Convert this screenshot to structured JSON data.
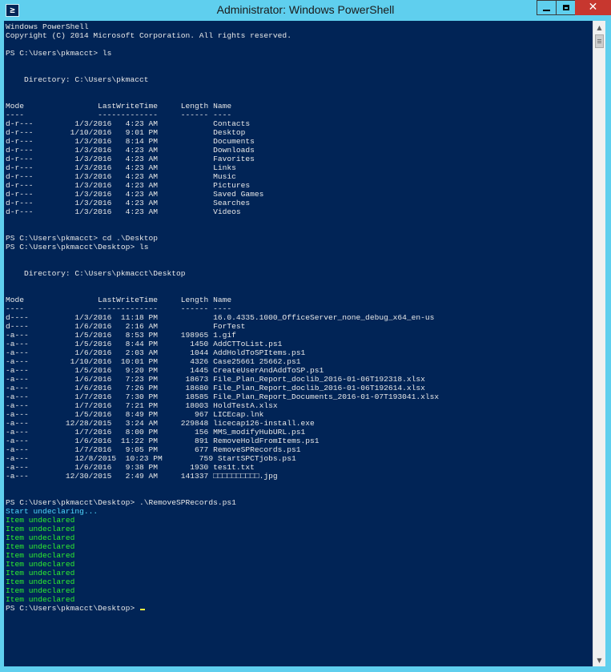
{
  "window": {
    "title": "Administrator: Windows PowerShell",
    "app_icon_glyph": "≥",
    "buttons": {
      "minimize_icon": "minimize-icon",
      "maximize_icon": "maximize-icon",
      "close_glyph": "✕"
    },
    "colors": {
      "frame": "#5fcfee",
      "console_background": "#012456",
      "text": "#e8e8e8",
      "highlight_text": "#52d8ff",
      "success_text": "#2ef02e",
      "cursor": "#ffff40",
      "close_button": "#c7372f"
    }
  },
  "console": {
    "lines": [
      {
        "text": "Windows PowerShell",
        "style": "normal"
      },
      {
        "text": "Copyright (C) 2014 Microsoft Corporation. All rights reserved.",
        "style": "normal"
      },
      {
        "text": "",
        "style": "normal"
      },
      {
        "text": "PS C:\\Users\\pkmacct> ls",
        "style": "normal"
      },
      {
        "text": "",
        "style": "normal"
      },
      {
        "text": "",
        "style": "normal"
      },
      {
        "text": "    Directory: C:\\Users\\pkmacct",
        "style": "normal"
      },
      {
        "text": "",
        "style": "normal"
      },
      {
        "text": "",
        "style": "normal"
      },
      {
        "text": "Mode                LastWriteTime     Length Name",
        "style": "normal"
      },
      {
        "text": "----                -------------     ------ ----",
        "style": "normal"
      },
      {
        "text": "d-r---         1/3/2016   4:23 AM            Contacts",
        "style": "normal"
      },
      {
        "text": "d-r---        1/10/2016   9:01 PM            Desktop",
        "style": "normal"
      },
      {
        "text": "d-r---         1/3/2016   8:14 PM            Documents",
        "style": "normal"
      },
      {
        "text": "d-r---         1/3/2016   4:23 AM            Downloads",
        "style": "normal"
      },
      {
        "text": "d-r---         1/3/2016   4:23 AM            Favorites",
        "style": "normal"
      },
      {
        "text": "d-r---         1/3/2016   4:23 AM            Links",
        "style": "normal"
      },
      {
        "text": "d-r---         1/3/2016   4:23 AM            Music",
        "style": "normal"
      },
      {
        "text": "d-r---         1/3/2016   4:23 AM            Pictures",
        "style": "normal"
      },
      {
        "text": "d-r---         1/3/2016   4:23 AM            Saved Games",
        "style": "normal"
      },
      {
        "text": "d-r---         1/3/2016   4:23 AM            Searches",
        "style": "normal"
      },
      {
        "text": "d-r---         1/3/2016   4:23 AM            Videos",
        "style": "normal"
      },
      {
        "text": "",
        "style": "normal"
      },
      {
        "text": "",
        "style": "normal"
      },
      {
        "text": "PS C:\\Users\\pkmacct> cd .\\Desktop",
        "style": "normal"
      },
      {
        "text": "PS C:\\Users\\pkmacct\\Desktop> ls",
        "style": "normal"
      },
      {
        "text": "",
        "style": "normal"
      },
      {
        "text": "",
        "style": "normal"
      },
      {
        "text": "    Directory: C:\\Users\\pkmacct\\Desktop",
        "style": "normal"
      },
      {
        "text": "",
        "style": "normal"
      },
      {
        "text": "",
        "style": "normal"
      },
      {
        "text": "Mode                LastWriteTime     Length Name",
        "style": "normal"
      },
      {
        "text": "----                -------------     ------ ----",
        "style": "normal"
      },
      {
        "text": "d----          1/3/2016  11:18 PM            16.0.4335.1000_OfficeServer_none_debug_x64_en-us",
        "style": "normal"
      },
      {
        "text": "d----          1/6/2016   2:16 AM            ForTest",
        "style": "normal"
      },
      {
        "text": "-a---          1/5/2016   8:53 PM     198965 1.gif",
        "style": "normal"
      },
      {
        "text": "-a---          1/5/2016   8:44 PM       1450 AddCTToList.ps1",
        "style": "normal"
      },
      {
        "text": "-a---          1/6/2016   2:03 AM       1044 AddHoldToSPItems.ps1",
        "style": "normal"
      },
      {
        "text": "-a---         1/10/2016  10:01 PM       4326 Case25661 25662.ps1",
        "style": "normal"
      },
      {
        "text": "-a---          1/5/2016   9:20 PM       1445 CreateUserAndAddToSP.ps1",
        "style": "normal"
      },
      {
        "text": "-a---          1/6/2016   7:23 PM      18673 File_Plan_Report_doclib_2016-01-06T192318.xlsx",
        "style": "normal"
      },
      {
        "text": "-a---          1/6/2016   7:26 PM      18680 File_Plan_Report_doclib_2016-01-06T192614.xlsx",
        "style": "normal"
      },
      {
        "text": "-a---          1/7/2016   7:30 PM      18585 File_Plan_Report_Documents_2016-01-07T193041.xlsx",
        "style": "normal"
      },
      {
        "text": "-a---          1/7/2016   7:21 PM      18003 HoldTestA.xlsx",
        "style": "normal"
      },
      {
        "text": "-a---          1/5/2016   8:49 PM        967 LICEcap.lnk",
        "style": "normal"
      },
      {
        "text": "-a---        12/28/2015   3:24 AM     229848 licecap126-install.exe",
        "style": "normal"
      },
      {
        "text": "-a---          1/7/2016   8:00 PM        156 MMS_modifyHubURL.ps1",
        "style": "normal"
      },
      {
        "text": "-a---          1/6/2016  11:22 PM        891 RemoveHoldFromItems.ps1",
        "style": "normal"
      },
      {
        "text": "-a---          1/7/2016   9:05 PM        677 RemoveSPRecords.ps1",
        "style": "normal"
      },
      {
        "text": "-a---          12/8/2015  10:23 PM        759 StartSPCTjobs.ps1",
        "style": "normal"
      },
      {
        "text": "-a---          1/6/2016   9:38 PM       1930 tes1t.txt",
        "style": "normal"
      },
      {
        "text": "-a---        12/30/2015   2:49 AM     141337 □□□□□□□□□□.jpg",
        "style": "normal"
      },
      {
        "text": "",
        "style": "normal"
      },
      {
        "text": "",
        "style": "normal"
      },
      {
        "text": "PS C:\\Users\\pkmacct\\Desktop> .\\RemoveSPRecords.ps1",
        "style": "normal"
      },
      {
        "text": "Start undeclaring...",
        "style": "hl"
      },
      {
        "text": "Item undeclared",
        "style": "ok"
      },
      {
        "text": "Item undeclared",
        "style": "ok"
      },
      {
        "text": "Item undeclared",
        "style": "ok"
      },
      {
        "text": "Item undeclared",
        "style": "ok"
      },
      {
        "text": "Item undeclared",
        "style": "ok"
      },
      {
        "text": "Item undeclared",
        "style": "ok"
      },
      {
        "text": "Item undeclared",
        "style": "ok"
      },
      {
        "text": "Item undeclared",
        "style": "ok"
      },
      {
        "text": "Item undeclared",
        "style": "ok"
      },
      {
        "text": "Item undeclared",
        "style": "ok"
      }
    ],
    "prompt": "PS C:\\Users\\pkmacct\\Desktop> "
  },
  "scrollbar": {
    "up_glyph": "▲",
    "down_glyph": "▼"
  }
}
